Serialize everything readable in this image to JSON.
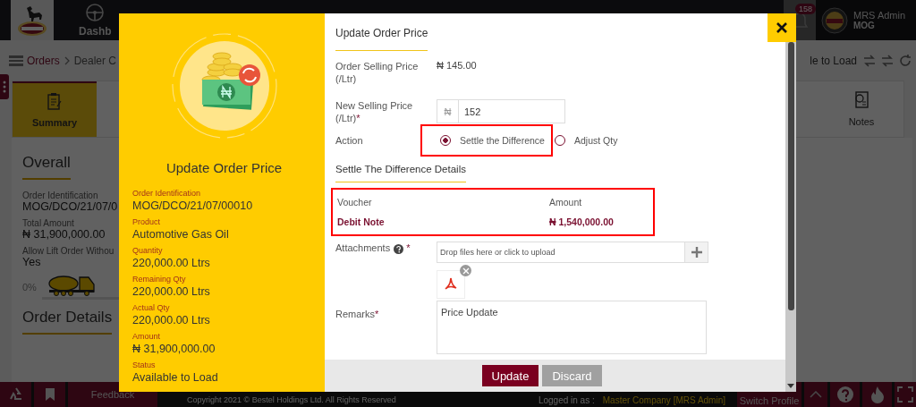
{
  "app": {
    "nav": {
      "items": [
        {
          "label": "Dashb"
        }
      ],
      "notification_count": "158",
      "user": {
        "name": "MRS Admin",
        "org": "MOG"
      }
    },
    "breadcrumb": [
      {
        "label": "Orders"
      },
      {
        "label": "Dealer C"
      }
    ],
    "status_text": "le to Load",
    "tabs": [
      {
        "label": "Summary",
        "selected": true
      },
      {
        "label": "Notes",
        "selected": false
      }
    ],
    "overall": {
      "title": "Overall",
      "fields": [
        {
          "label": "Order Identification",
          "value": "MOG/DCO/21/07/0"
        },
        {
          "label": "Total Amount",
          "value": "₦ 31,900,000.00"
        },
        {
          "label": "Allow Lift Order Withou",
          "value": "Yes"
        }
      ],
      "progress": {
        "reading": "0%",
        "level": 0
      }
    },
    "order_details": {
      "title": "Order Details"
    },
    "footer": {
      "feedback": "Feedback",
      "copyright": "Copyright 2021 © Bestel Holdings Ltd. All Rights Reserved",
      "logged_in_label": "Logged in as :",
      "logged_in_value": "Master Company [MRS Admin]",
      "switch_profile": "Switch Profile"
    }
  },
  "modal": {
    "sidebar": {
      "title": "Update Order Price",
      "fields": [
        {
          "label": "Order Identification",
          "value": "MOG/DCO/21/07/00010"
        },
        {
          "label": "Product",
          "value": "Automotive Gas Oil"
        },
        {
          "label": "Quantity",
          "value": "220,000.00 Ltrs"
        },
        {
          "label": "Remaining Qty",
          "value": "220,000.00 Ltrs"
        },
        {
          "label": "Actual Qty",
          "value": "220,000.00 Ltrs"
        },
        {
          "label": "Amount",
          "value": "₦ 31,900,000.00"
        },
        {
          "label": "Status",
          "value": "Available to Load"
        }
      ]
    },
    "form": {
      "title": "Update Order Price",
      "selling_price": {
        "label": "Order Selling Price (/Ltr)",
        "value": "₦ 145.00"
      },
      "new_price": {
        "label": "New Selling Price (/Ltr)",
        "required_mark": "*",
        "currency": "₦",
        "value": "152"
      },
      "action": {
        "label": "Action",
        "highlighted": true,
        "options": [
          {
            "label": "Settle the Difference",
            "selected": true
          },
          {
            "label": "Adjust Qty",
            "selected": false
          }
        ]
      },
      "details": {
        "title": "Settle The Difference Details",
        "highlighted": true,
        "columns": [
          "Voucher",
          "Amount"
        ],
        "rows": [
          [
            "Debit Note",
            "₦ 1,540,000.00"
          ]
        ]
      },
      "attachments": {
        "label": "Attachments",
        "required_mark": "*",
        "placeholder": "Drop files here or click to upload",
        "files": [
          {
            "kind": "pdf"
          }
        ]
      },
      "remarks": {
        "label": "Remarks",
        "required_mark": "*",
        "value": "Price Update"
      },
      "buttons": [
        {
          "label": "Update",
          "kind": "primary"
        },
        {
          "label": "Discard",
          "kind": "secondary"
        }
      ]
    }
  }
}
